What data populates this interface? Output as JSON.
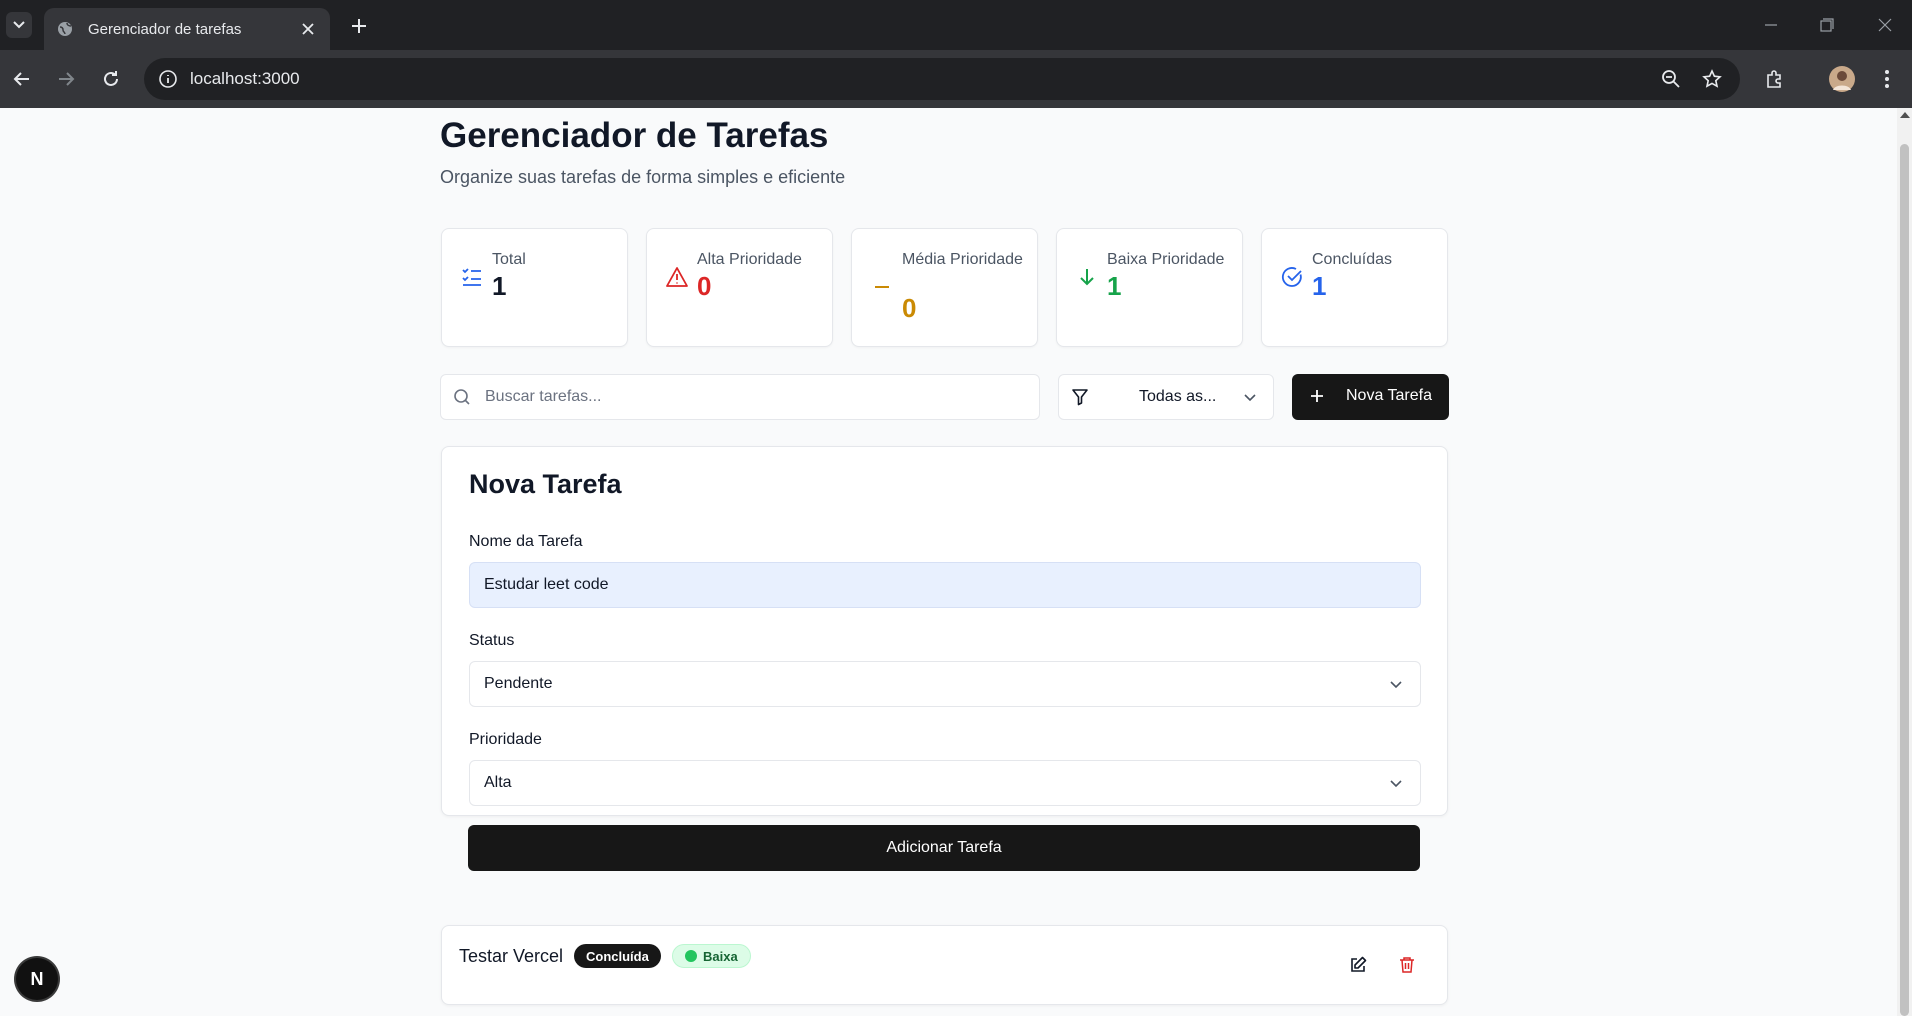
{
  "browser": {
    "tab_title": "Gerenciador de tarefas",
    "url": "localhost:3000"
  },
  "page": {
    "title": "Gerenciador de Tarefas",
    "subtitle": "Organize suas tarefas de forma simples e eficiente"
  },
  "stats": [
    {
      "label": "Total",
      "value": "1",
      "icon": "list-check-icon",
      "color": "#111827",
      "icon_color": "#2563eb"
    },
    {
      "label": "Alta Prioridade",
      "value": "0",
      "icon": "alert-triangle-icon",
      "color": "#dc2626",
      "icon_color": "#dc2626"
    },
    {
      "label": "Média Prioridade",
      "value": "0",
      "icon": "minus-icon",
      "color": "#ca8a04",
      "icon_color": "#ca8a04"
    },
    {
      "label": "Baixa Prioridade",
      "value": "1",
      "icon": "arrow-down-icon",
      "color": "#16a34a",
      "icon_color": "#16a34a"
    },
    {
      "label": "Concluídas",
      "value": "1",
      "icon": "check-circle-icon",
      "color": "#2563eb",
      "icon_color": "#2563eb"
    }
  ],
  "toolbar": {
    "search_placeholder": "Buscar tarefas...",
    "filter_value": "Todas as...",
    "new_task_label": "Nova Tarefa"
  },
  "form": {
    "title": "Nova Tarefa",
    "name_label": "Nome da Tarefa",
    "name_value": "Estudar leet code",
    "status_label": "Status",
    "status_value": "Pendente",
    "priority_label": "Prioridade",
    "priority_value": "Alta",
    "submit_label": "Adicionar Tarefa"
  },
  "tasks": [
    {
      "name": "Testar Vercel",
      "status": "Concluída",
      "priority": "Baixa"
    }
  ],
  "dev_badge": "N"
}
